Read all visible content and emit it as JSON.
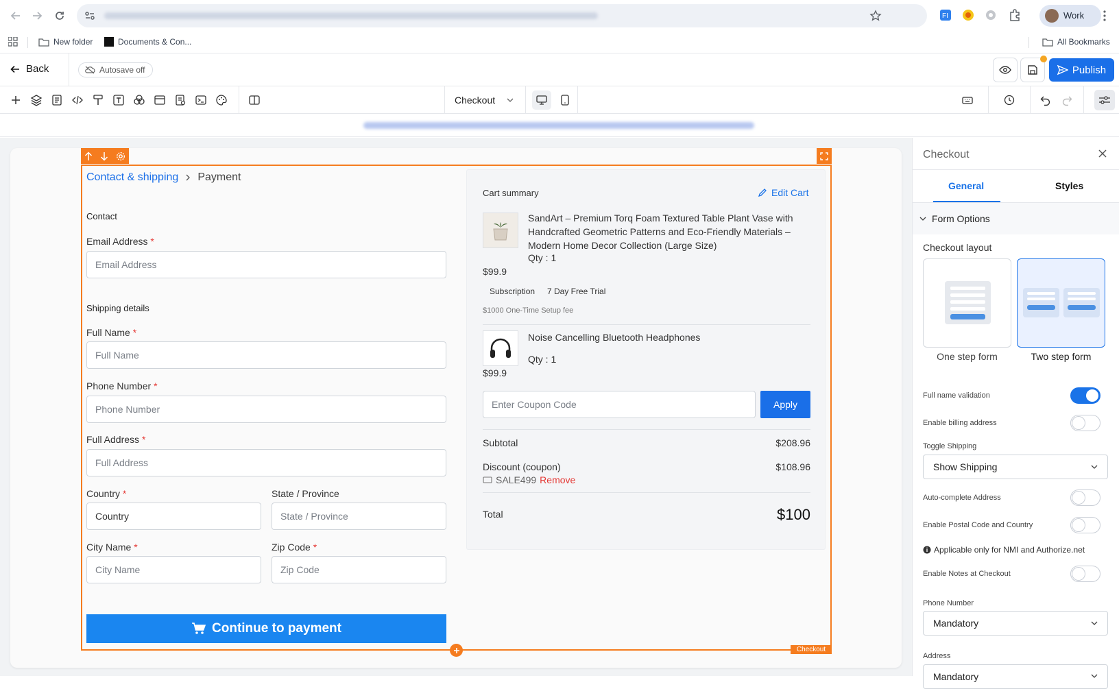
{
  "browser": {
    "profile": "Work",
    "bookmarks": [
      "New folder",
      "Documents & Con..."
    ],
    "all_bookmarks": "All Bookmarks"
  },
  "header": {
    "back": "Back",
    "autosave": "Autosave off",
    "publish": "Publish"
  },
  "toolbar": {
    "page_select": "Checkout"
  },
  "canvas": {
    "breadcrumb": {
      "step1": "Contact & shipping",
      "step2": "Payment"
    },
    "section_contact": "Contact",
    "email_label": "Email Address",
    "email_placeholder": "Email Address",
    "section_shipping": "Shipping details",
    "fullname_label": "Full Name",
    "fullname_placeholder": "Full Name",
    "phone_label": "Phone Number",
    "phone_placeholder": "Phone Number",
    "address_label": "Full Address",
    "address_placeholder": "Full Address",
    "country_label": "Country",
    "country_placeholder": "Country",
    "state_label": "State / Province",
    "state_placeholder": "State / Province",
    "city_label": "City Name",
    "city_placeholder": "City Name",
    "zip_label": "Zip Code",
    "zip_placeholder": "Zip Code",
    "required_mark": "*",
    "continue_button": "Continue to payment",
    "element_tag": "Checkout"
  },
  "cart": {
    "title": "Cart summary",
    "edit": "Edit Cart",
    "items": [
      {
        "name": "SandArt – Premium Torq Foam Textured Table Plant Vase with Handcrafted Geometric Patterns and Eco-Friendly Materials – Modern Home Decor Collection (Large Size)",
        "qty": "Qty : 1",
        "price": "$99.9",
        "badge1": "Subscription",
        "badge2": "7 Day Free Trial",
        "setup_fee": "$1000 One-Time Setup fee"
      },
      {
        "name": "Noise Cancelling Bluetooth Headphones",
        "qty": "Qty : 1",
        "price": "$99.9"
      }
    ],
    "coupon_placeholder": "Enter Coupon Code",
    "apply": "Apply",
    "subtotal_label": "Subtotal",
    "subtotal_value": "$208.96",
    "discount_label": "Discount (coupon)",
    "discount_value": "$108.96",
    "coupon_code": "SALE499",
    "remove": "Remove",
    "total_label": "Total",
    "total_value": "$100"
  },
  "panel": {
    "title": "Checkout",
    "tabs": [
      "General",
      "Styles"
    ],
    "section": "Form Options",
    "layout_label": "Checkout layout",
    "layout_one": "One step form",
    "layout_two": "Two step form",
    "full_name_validation": "Full name validation",
    "enable_billing": "Enable billing address",
    "toggle_shipping_label": "Toggle Shipping",
    "toggle_shipping_value": "Show Shipping",
    "autocomplete": "Auto-complete Address",
    "postal_country": "Enable Postal Code and Country",
    "info_note": "Applicable only for NMI and Authorize.net",
    "notes_checkout": "Enable Notes at Checkout",
    "phone_label": "Phone Number",
    "phone_value": "Mandatory",
    "address_label": "Address",
    "address_value": "Mandatory"
  },
  "colors": {
    "accent": "#1a73e8",
    "selection": "#f57c1f",
    "required": "#e53935"
  }
}
